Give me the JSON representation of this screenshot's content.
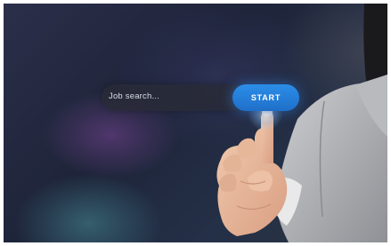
{
  "search": {
    "placeholder": "Job search...",
    "button_label": "START"
  },
  "colors": {
    "button": "#2480da",
    "background": "#232a40"
  },
  "icons": [
    "pointing-hand-icon"
  ]
}
